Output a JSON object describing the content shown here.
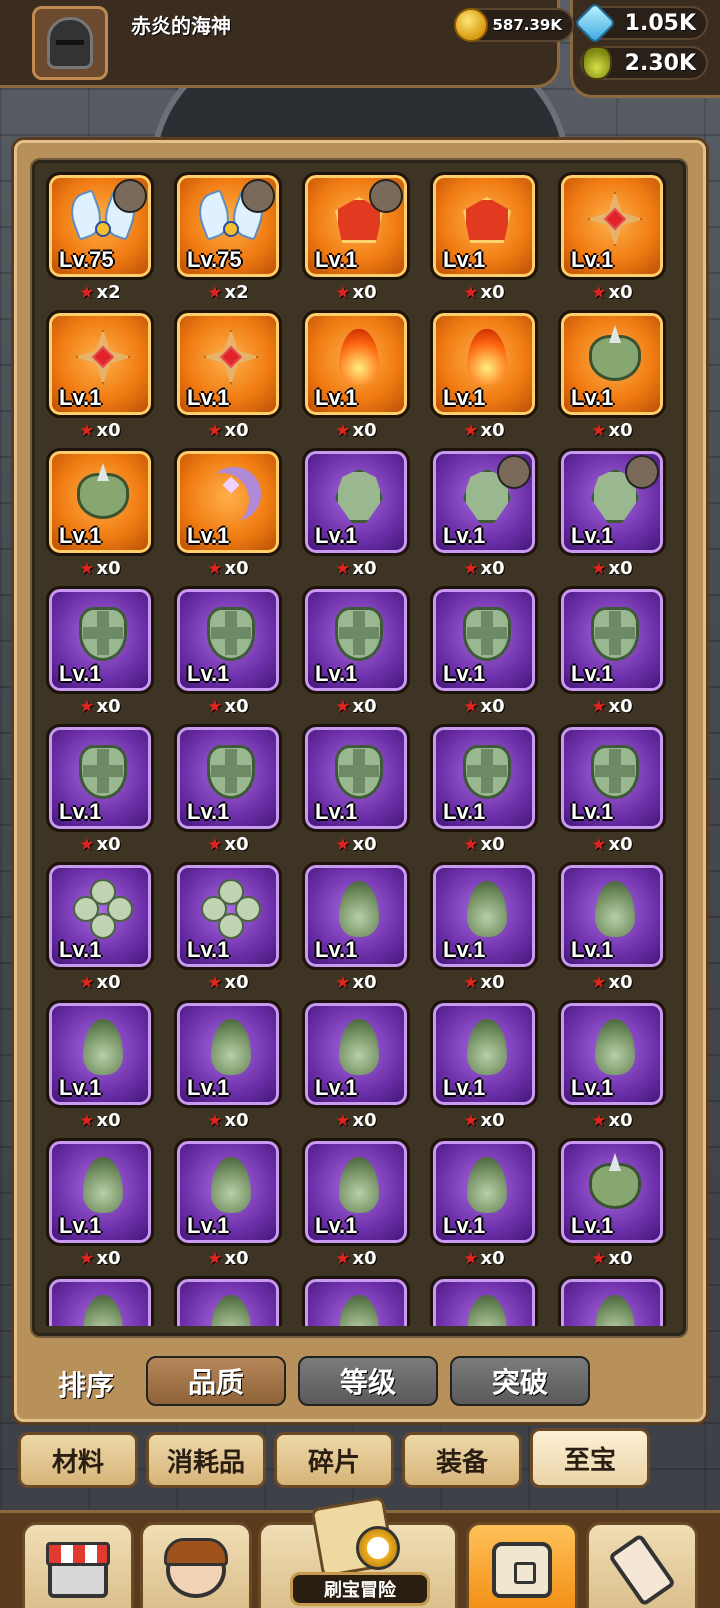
{
  "header": {
    "player_name": "赤炎的海神",
    "gold": "587.39K",
    "gems": "1.05K",
    "potion": "2.30K"
  },
  "items": [
    {
      "rarity": "orange",
      "emblem": "wings",
      "level": "Lv.75",
      "stars": "x2",
      "owner": true
    },
    {
      "rarity": "orange",
      "emblem": "wings",
      "level": "Lv.75",
      "stars": "x2",
      "owner": true
    },
    {
      "rarity": "orange",
      "emblem": "crown",
      "level": "Lv.1",
      "stars": "x0",
      "owner": true
    },
    {
      "rarity": "orange",
      "emblem": "crown",
      "level": "Lv.1",
      "stars": "x0",
      "owner": false
    },
    {
      "rarity": "orange",
      "emblem": "cross",
      "level": "Lv.1",
      "stars": "x0",
      "owner": false
    },
    {
      "rarity": "orange",
      "emblem": "cross",
      "level": "Lv.1",
      "stars": "x0",
      "owner": false
    },
    {
      "rarity": "orange",
      "emblem": "cross",
      "level": "Lv.1",
      "stars": "x0",
      "owner": false
    },
    {
      "rarity": "orange",
      "emblem": "flame",
      "level": "Lv.1",
      "stars": "x0",
      "owner": false
    },
    {
      "rarity": "orange",
      "emblem": "flame",
      "level": "Lv.1",
      "stars": "x0",
      "owner": false
    },
    {
      "rarity": "orange",
      "emblem": "beast",
      "level": "Lv.1",
      "stars": "x0",
      "owner": false
    },
    {
      "rarity": "orange",
      "emblem": "beast",
      "level": "Lv.1",
      "stars": "x0",
      "owner": false
    },
    {
      "rarity": "orange",
      "emblem": "moon",
      "level": "Lv.1",
      "stars": "x0",
      "owner": false
    },
    {
      "rarity": "purple",
      "emblem": "mask",
      "level": "Lv.1",
      "stars": "x0",
      "owner": false
    },
    {
      "rarity": "purple",
      "emblem": "mask",
      "level": "Lv.1",
      "stars": "x0",
      "owner": true
    },
    {
      "rarity": "purple",
      "emblem": "mask",
      "level": "Lv.1",
      "stars": "x0",
      "owner": true
    },
    {
      "rarity": "purple",
      "emblem": "shield",
      "level": "Lv.1",
      "stars": "x0",
      "owner": false
    },
    {
      "rarity": "purple",
      "emblem": "shield",
      "level": "Lv.1",
      "stars": "x0",
      "owner": false
    },
    {
      "rarity": "purple",
      "emblem": "shield",
      "level": "Lv.1",
      "stars": "x0",
      "owner": false
    },
    {
      "rarity": "purple",
      "emblem": "shield",
      "level": "Lv.1",
      "stars": "x0",
      "owner": false
    },
    {
      "rarity": "purple",
      "emblem": "shield",
      "level": "Lv.1",
      "stars": "x0",
      "owner": false
    },
    {
      "rarity": "purple",
      "emblem": "shield",
      "level": "Lv.1",
      "stars": "x0",
      "owner": false
    },
    {
      "rarity": "purple",
      "emblem": "shield",
      "level": "Lv.1",
      "stars": "x0",
      "owner": false
    },
    {
      "rarity": "purple",
      "emblem": "shield",
      "level": "Lv.1",
      "stars": "x0",
      "owner": false
    },
    {
      "rarity": "purple",
      "emblem": "shield",
      "level": "Lv.1",
      "stars": "x0",
      "owner": false
    },
    {
      "rarity": "purple",
      "emblem": "shield",
      "level": "Lv.1",
      "stars": "x0",
      "owner": false
    },
    {
      "rarity": "purple",
      "emblem": "clover",
      "level": "Lv.1",
      "stars": "x0",
      "owner": false
    },
    {
      "rarity": "purple",
      "emblem": "clover",
      "level": "Lv.1",
      "stars": "x0",
      "owner": false
    },
    {
      "rarity": "purple",
      "emblem": "leaf",
      "level": "Lv.1",
      "stars": "x0",
      "owner": false
    },
    {
      "rarity": "purple",
      "emblem": "leaf",
      "level": "Lv.1",
      "stars": "x0",
      "owner": false
    },
    {
      "rarity": "purple",
      "emblem": "leaf",
      "level": "Lv.1",
      "stars": "x0",
      "owner": false
    },
    {
      "rarity": "purple",
      "emblem": "leaf",
      "level": "Lv.1",
      "stars": "x0",
      "owner": false
    },
    {
      "rarity": "purple",
      "emblem": "leaf",
      "level": "Lv.1",
      "stars": "x0",
      "owner": false
    },
    {
      "rarity": "purple",
      "emblem": "leaf",
      "level": "Lv.1",
      "stars": "x0",
      "owner": false
    },
    {
      "rarity": "purple",
      "emblem": "leaf",
      "level": "Lv.1",
      "stars": "x0",
      "owner": false
    },
    {
      "rarity": "purple",
      "emblem": "leaf",
      "level": "Lv.1",
      "stars": "x0",
      "owner": false
    },
    {
      "rarity": "purple",
      "emblem": "leaf",
      "level": "Lv.1",
      "stars": "x0",
      "owner": false
    },
    {
      "rarity": "purple",
      "emblem": "leaf",
      "level": "Lv.1",
      "stars": "x0",
      "owner": false
    },
    {
      "rarity": "purple",
      "emblem": "leaf",
      "level": "Lv.1",
      "stars": "x0",
      "owner": false
    },
    {
      "rarity": "purple",
      "emblem": "leaf",
      "level": "Lv.1",
      "stars": "x0",
      "owner": false
    },
    {
      "rarity": "purple",
      "emblem": "beast",
      "level": "Lv.1",
      "stars": "x0",
      "owner": false
    },
    {
      "rarity": "purple",
      "emblem": "leaf",
      "level": "",
      "stars": "",
      "owner": false
    },
    {
      "rarity": "purple",
      "emblem": "leaf",
      "level": "",
      "stars": "",
      "owner": false
    },
    {
      "rarity": "purple",
      "emblem": "leaf",
      "level": "",
      "stars": "",
      "owner": false
    },
    {
      "rarity": "purple",
      "emblem": "leaf",
      "level": "",
      "stars": "",
      "owner": false
    },
    {
      "rarity": "purple",
      "emblem": "leaf",
      "level": "",
      "stars": "",
      "owner": false
    }
  ],
  "sort": {
    "label": "排序",
    "options": [
      "品质",
      "等级",
      "突破"
    ],
    "active_index": 0
  },
  "tabs": {
    "items": [
      "材料",
      "消耗品",
      "碎片",
      "装备",
      "至宝"
    ],
    "selected_index": 4
  },
  "bottom_nav": {
    "adventure_label": "刷宝冒险",
    "selected": "bag"
  },
  "colors": {
    "orange_rarity": "#f07b12",
    "purple_rarity": "#6c2ea8",
    "star": "#e0261c"
  }
}
